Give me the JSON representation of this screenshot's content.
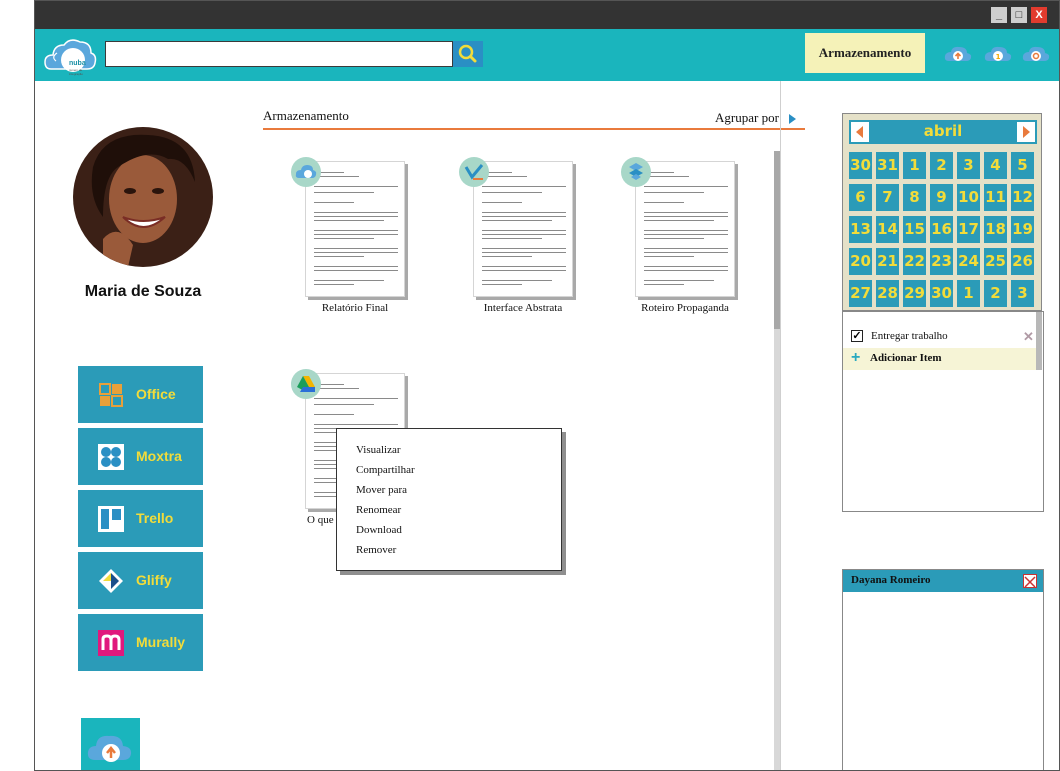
{
  "window": {
    "minimize": "_",
    "maximize": "□",
    "close": "X"
  },
  "header": {
    "logo_text": "nuba",
    "logo_subtext": "nuvem de integração",
    "search": {
      "value": "",
      "placeholder": ""
    },
    "storage_button": "Armazenamento",
    "icons": [
      "upload-cloud-icon",
      "info-cloud-icon",
      "settings-cloud-icon"
    ]
  },
  "user": {
    "name": "Maria de Souza"
  },
  "apps": [
    {
      "label": "Office",
      "icon": "office-icon"
    },
    {
      "label": "Moxtra",
      "icon": "moxtra-icon"
    },
    {
      "label": "Trello",
      "icon": "trello-icon"
    },
    {
      "label": "Gliffy",
      "icon": "gliffy-icon"
    },
    {
      "label": "Murally",
      "icon": "murally-icon"
    }
  ],
  "storage": {
    "title": "Armazenamento",
    "group_by": "Agrupar por",
    "files": [
      {
        "name": "Relatório Final",
        "source": "cloud-storage-icon"
      },
      {
        "name": "Interface Abstrata",
        "source": "drive-check-icon"
      },
      {
        "name": "Roteiro Propaganda",
        "source": "dropbox-icon"
      },
      {
        "name": "O que",
        "source": "google-drive-icon"
      }
    ]
  },
  "context_menu": [
    "Visualizar",
    "Compartilhar",
    "Mover para",
    "Renomear",
    "Download",
    "Remover"
  ],
  "calendar": {
    "month": "abril",
    "weeks": [
      [
        "30",
        "31",
        "1",
        "2",
        "3",
        "4",
        "5"
      ],
      [
        "6",
        "7",
        "8",
        "9",
        "10",
        "11",
        "12"
      ],
      [
        "13",
        "14",
        "15",
        "16",
        "17",
        "18",
        "19"
      ],
      [
        "20",
        "21",
        "22",
        "23",
        "24",
        "25",
        "26"
      ],
      [
        "27",
        "28",
        "29",
        "30",
        "1",
        "2",
        "3"
      ]
    ]
  },
  "todo": {
    "items": [
      {
        "label": "Entregar trabalho",
        "checked": true
      }
    ],
    "add_label": "Adicionar Item"
  },
  "chat": {
    "contact": "Dayana Romeiro"
  },
  "colors": {
    "teal": "#1ab5bd",
    "blue": "#2b9bb8",
    "yellow": "#f2dc3a",
    "orange": "#e97a3c",
    "storage_bg": "#f5f2b8"
  }
}
